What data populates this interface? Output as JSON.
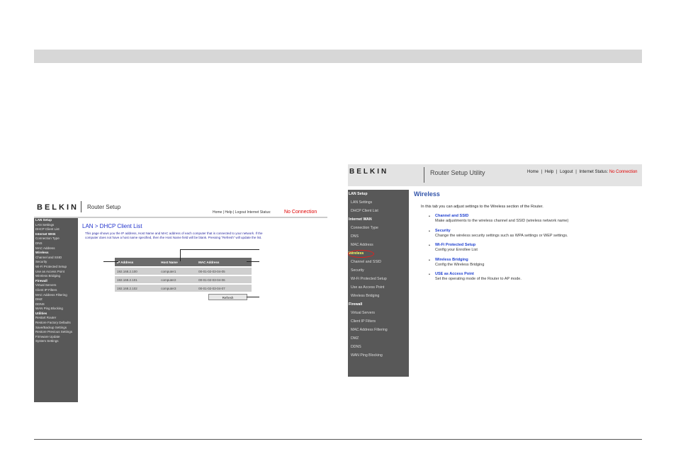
{
  "shot1": {
    "logo": "BELKIN",
    "title": "Router Setup",
    "header_links": "Home | Help | Logout   Internet Status:",
    "connection_status": "No Connection",
    "sidebar": [
      {
        "label": "LAN Setup",
        "cat": true
      },
      {
        "label": "LAN Settings"
      },
      {
        "label": "DHCP Client List"
      },
      {
        "label": "Internet WAN",
        "cat": true
      },
      {
        "label": "Connection Type"
      },
      {
        "label": "DNS"
      },
      {
        "label": "MAC Address"
      },
      {
        "label": "Wireless",
        "cat": true
      },
      {
        "label": "Channel and SSID"
      },
      {
        "label": "Security"
      },
      {
        "label": "Wi-Fi Protected Setup"
      },
      {
        "label": "Use as Access Point"
      },
      {
        "label": "Wireless Bridging"
      },
      {
        "label": "Firewall",
        "cat": true
      },
      {
        "label": "Virtual Servers"
      },
      {
        "label": "Client IP Filters"
      },
      {
        "label": "MAC Address Filtering"
      },
      {
        "label": "DMZ"
      },
      {
        "label": "DDNS"
      },
      {
        "label": "WAN Ping Blocking"
      },
      {
        "label": "Utilities",
        "cat": true
      },
      {
        "label": "Restart Router"
      },
      {
        "label": "Restore Factory Defaults"
      },
      {
        "label": "Save/Backup Settings"
      },
      {
        "label": "Restore Previous Settings"
      },
      {
        "label": "Firmware Update"
      },
      {
        "label": "System Settings"
      }
    ],
    "page_title": "LAN > DHCP Client List",
    "description": "This page shows you the IP address, Host Name and MAC address of each computer that is connected to your network. If the computer does not have a host name specified, then the Host Name field will be blank. Pressing \"Refresh\" will update the list.",
    "table": {
      "headers": [
        "IP Address",
        "Host Name",
        "MAC Address"
      ],
      "rows": [
        [
          "192.168.2.100",
          "computer1",
          "00-01-02-03-04-05"
        ],
        [
          "192.168.2.101",
          "computer2",
          "00-01-02-03-04-06"
        ],
        [
          "192.168.2.102",
          "computer3",
          "00-01-02-03-04-07"
        ]
      ]
    },
    "refresh_label": "Refresh"
  },
  "shot2": {
    "logo": "BELKIN",
    "title": "Router Setup Utility",
    "links": {
      "home": "Home",
      "help": "Help",
      "logout": "Logout",
      "status_label": "Internet Status:",
      "status_value": "No Connection"
    },
    "sidebar": [
      {
        "label": "LAN Setup",
        "cat": true
      },
      {
        "label": "LAN Settings"
      },
      {
        "label": "DHCP Client List"
      },
      {
        "label": "Internet WAN",
        "cat": true
      },
      {
        "label": "Connection Type"
      },
      {
        "label": "DNS"
      },
      {
        "label": "MAC Address"
      },
      {
        "label": "Wireless",
        "cat": true,
        "active": true
      },
      {
        "label": "Channel and SSID"
      },
      {
        "label": "Security"
      },
      {
        "label": "Wi-Fi Protected Setup"
      },
      {
        "label": "Use as Access Point"
      },
      {
        "label": "Wireless Bridging"
      },
      {
        "label": "Firewall",
        "cat": true
      },
      {
        "label": "Virtual Servers"
      },
      {
        "label": "Client IP Filters"
      },
      {
        "label": "MAC Address Filtering"
      },
      {
        "label": "DMZ"
      },
      {
        "label": "DDNS"
      },
      {
        "label": "WAN Ping Blocking"
      }
    ],
    "page_title": "Wireless",
    "intro": "In this tab you can adjust settings to the Wireless section of the Router.",
    "entries": [
      {
        "link": "Channel and SSID",
        "desc": "Make adjustments to the wireless channel and SSID (wireless network name)"
      },
      {
        "link": "Security",
        "desc": "Change the wireless security settings such as WPA settings or WEP settings."
      },
      {
        "link": "Wi-Fi Protected Setup",
        "desc": "Config your Enrollee List"
      },
      {
        "link": "Wireless Bridging",
        "desc": "Config the Wireless Bridging"
      },
      {
        "link": "USE as Access Point",
        "desc": "Set the operating mode of the Router to AP mode."
      }
    ]
  }
}
